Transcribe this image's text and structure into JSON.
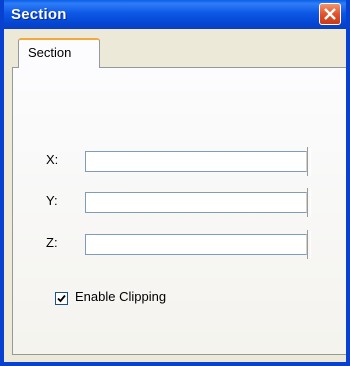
{
  "window": {
    "title": "Section"
  },
  "tabs": [
    {
      "label": "Section"
    }
  ],
  "fields": [
    {
      "label": "X:",
      "value": ""
    },
    {
      "label": "Y:",
      "value": ""
    },
    {
      "label": "Z:",
      "value": ""
    }
  ],
  "clipping": {
    "label": "Enable Clipping",
    "checked": true
  },
  "icons": {
    "close": "close-icon",
    "check": "check-icon"
  },
  "colors": {
    "titlebar": "#0a5fe8",
    "close_button": "#e2532c",
    "window_background": "#ece9d8",
    "active_tab_highlight": "#f3a93b"
  }
}
